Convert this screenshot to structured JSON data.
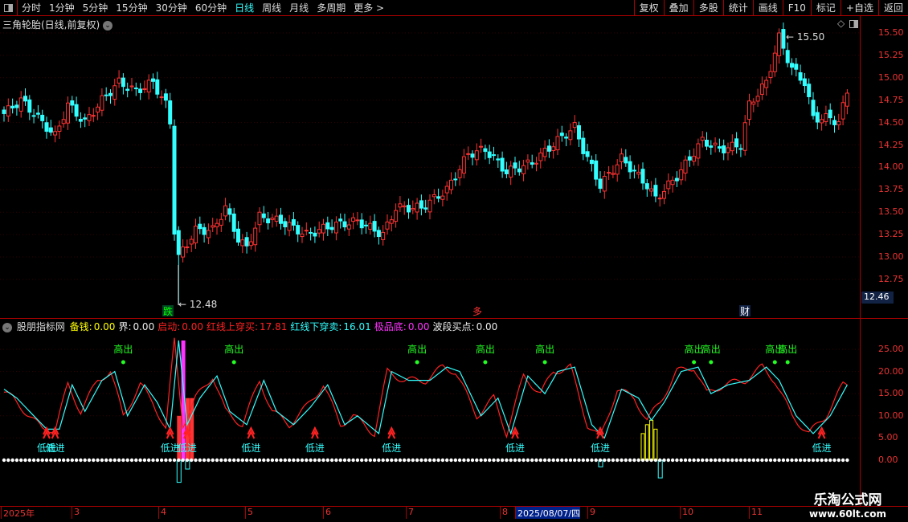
{
  "toolbar": {
    "periods": [
      "分时",
      "1分钟",
      "5分钟",
      "15分钟",
      "30分钟",
      "60分钟",
      "日线",
      "周线",
      "月线",
      "多周期",
      "更多 >"
    ],
    "active": "日线",
    "right_buttons": [
      "复权",
      "叠加",
      "多股",
      "统计",
      "画线",
      "F10",
      "标记",
      "+自选",
      "返回"
    ]
  },
  "chart_title": "三角轮胎(日线,前复权)",
  "price_axis": [
    "15.50",
    "15.25",
    "15.00",
    "14.75",
    "14.50",
    "14.25",
    "14.00",
    "13.75",
    "13.50",
    "13.25",
    "13.00",
    "12.75"
  ],
  "current_price": "12.46",
  "high_label": "15.50",
  "low_label": "12.48",
  "markers": {
    "die": "跌",
    "cai": "财",
    "red": "多"
  },
  "indicator": {
    "name": "股朋指标网",
    "items": [
      {
        "label": "备钱:",
        "value": "0.00",
        "color": "#ff0"
      },
      {
        "label": "界:",
        "value": "0.00",
        "color": "#eee"
      },
      {
        "label": "启动:",
        "value": "0.00",
        "color": "#f22"
      },
      {
        "label": "红线上穿买:",
        "value": "17.81",
        "color": "#f22"
      },
      {
        "label": "红线下穿卖:",
        "value": "16.01",
        "color": "#3ff"
      },
      {
        "label": "极品底:",
        "value": "0.00",
        "color": "#f3f"
      },
      {
        "label": "波段买点:",
        "value": "0.00",
        "color": "#eee"
      }
    ],
    "axis": [
      "25.00",
      "20.00",
      "15.00",
      "10.00",
      "5.00",
      "0.00"
    ],
    "high_label": "高出",
    "low_label": "低进"
  },
  "dates": [
    "2025年",
    "3",
    "4",
    "5",
    "6",
    "7",
    "8",
    "2025/08/07/四",
    "9",
    "10",
    "11"
  ],
  "watermark": {
    "name": "乐淘公式网",
    "url": "www.60lt.com"
  },
  "colors": {
    "up": "#ff3333",
    "down": "#33ffff",
    "grid": "#aa0000"
  },
  "price_anchors": [
    [
      0,
      14.6
    ],
    [
      4,
      14.75
    ],
    [
      8,
      14.55
    ],
    [
      12,
      14.35
    ],
    [
      15,
      14.7
    ],
    [
      19,
      14.5
    ],
    [
      23,
      14.75
    ],
    [
      27,
      14.95
    ],
    [
      31,
      14.85
    ],
    [
      35,
      14.95
    ],
    [
      38,
      14.7
    ],
    [
      39,
      14.5
    ],
    [
      40,
      13.3
    ],
    [
      41,
      13.0
    ],
    [
      45,
      13.3
    ],
    [
      49,
      13.3
    ],
    [
      52,
      13.55
    ],
    [
      55,
      13.2
    ],
    [
      57,
      13.1
    ],
    [
      60,
      13.45
    ],
    [
      65,
      13.4
    ],
    [
      71,
      13.25
    ],
    [
      77,
      13.35
    ],
    [
      83,
      13.4
    ],
    [
      89,
      13.25
    ],
    [
      92,
      13.55
    ],
    [
      98,
      13.55
    ],
    [
      104,
      13.75
    ],
    [
      109,
      14.15
    ],
    [
      113,
      14.2
    ],
    [
      118,
      13.95
    ],
    [
      124,
      14.05
    ],
    [
      130,
      14.3
    ],
    [
      134,
      14.45
    ],
    [
      136,
      14.2
    ],
    [
      140,
      13.8
    ],
    [
      145,
      14.1
    ],
    [
      151,
      13.8
    ],
    [
      153,
      13.65
    ],
    [
      158,
      13.9
    ],
    [
      164,
      14.3
    ],
    [
      168,
      14.2
    ],
    [
      173,
      14.25
    ],
    [
      175,
      14.7
    ],
    [
      179,
      14.95
    ],
    [
      182,
      15.45
    ],
    [
      185,
      15.1
    ],
    [
      188,
      14.95
    ],
    [
      190,
      14.55
    ],
    [
      194,
      14.55
    ],
    [
      196,
      14.5
    ],
    [
      198,
      14.85
    ]
  ],
  "osc_anchors": [
    [
      0,
      16
    ],
    [
      3,
      14
    ],
    [
      6,
      11
    ],
    [
      10,
      7
    ],
    [
      13,
      7
    ],
    [
      16,
      17
    ],
    [
      19,
      11
    ],
    [
      23,
      18
    ],
    [
      26,
      20
    ],
    [
      29,
      10
    ],
    [
      33,
      17
    ],
    [
      36,
      13
    ],
    [
      39,
      7
    ],
    [
      41,
      27
    ],
    [
      43,
      8
    ],
    [
      46,
      14
    ],
    [
      50,
      19
    ],
    [
      53,
      11
    ],
    [
      57,
      8
    ],
    [
      61,
      18
    ],
    [
      64,
      11
    ],
    [
      68,
      8
    ],
    [
      72,
      12
    ],
    [
      76,
      17
    ],
    [
      80,
      8
    ],
    [
      83,
      10
    ],
    [
      88,
      6
    ],
    [
      91,
      20
    ],
    [
      95,
      18
    ],
    [
      100,
      18
    ],
    [
      104,
      21
    ],
    [
      107,
      20
    ],
    [
      112,
      10
    ],
    [
      116,
      14
    ],
    [
      119,
      6
    ],
    [
      123,
      19
    ],
    [
      127,
      15
    ],
    [
      130,
      20
    ],
    [
      134,
      21
    ],
    [
      138,
      8
    ],
    [
      141,
      5
    ],
    [
      145,
      16
    ],
    [
      149,
      14
    ],
    [
      152,
      9
    ],
    [
      155,
      13
    ],
    [
      159,
      20
    ],
    [
      163,
      21
    ],
    [
      166,
      15
    ],
    [
      170,
      17
    ],
    [
      175,
      18
    ],
    [
      179,
      21
    ],
    [
      182,
      18
    ],
    [
      186,
      10
    ],
    [
      190,
      6
    ],
    [
      194,
      10
    ],
    [
      198,
      17
    ]
  ],
  "high_days": [
    28,
    54,
    97,
    113,
    127,
    162,
    166,
    181,
    184
  ],
  "low_days": [
    10,
    12,
    39,
    43,
    58,
    73,
    91,
    120,
    140,
    192
  ]
}
